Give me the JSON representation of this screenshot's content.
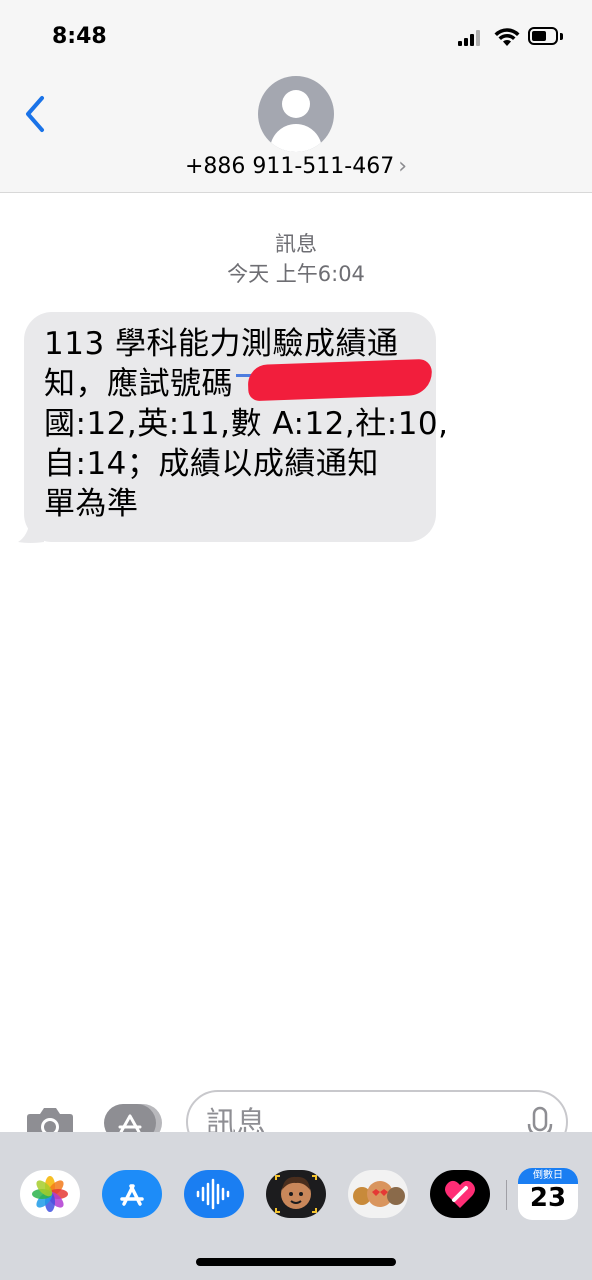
{
  "status_bar": {
    "time": "8:48"
  },
  "header": {
    "contact": "+886 911-511-467",
    "chevron": "›"
  },
  "thread": {
    "service": "訊息",
    "timestamp": "今天 上午6:04",
    "message": {
      "lines": [
        "113 學科能力測驗成績通",
        "知，應試號碼",
        "國:12,英:11,數 A:12,社:10,",
        "自:14；成績以成績通知",
        "單為準"
      ],
      "redaction_color": "#f21e3c"
    }
  },
  "composer": {
    "placeholder": "訊息"
  },
  "app_tray": {
    "items": [
      "photos-icon",
      "app-store-icon",
      "audio-message-icon",
      "memoji-icon",
      "memoji-stickers-icon",
      "digital-touch-icon",
      "countdown-app-icon"
    ],
    "countdown": {
      "header": "倒數日",
      "value": "23"
    }
  },
  "colors": {
    "accent": "#1a7ef2",
    "bubble": "#e9e9eb"
  }
}
